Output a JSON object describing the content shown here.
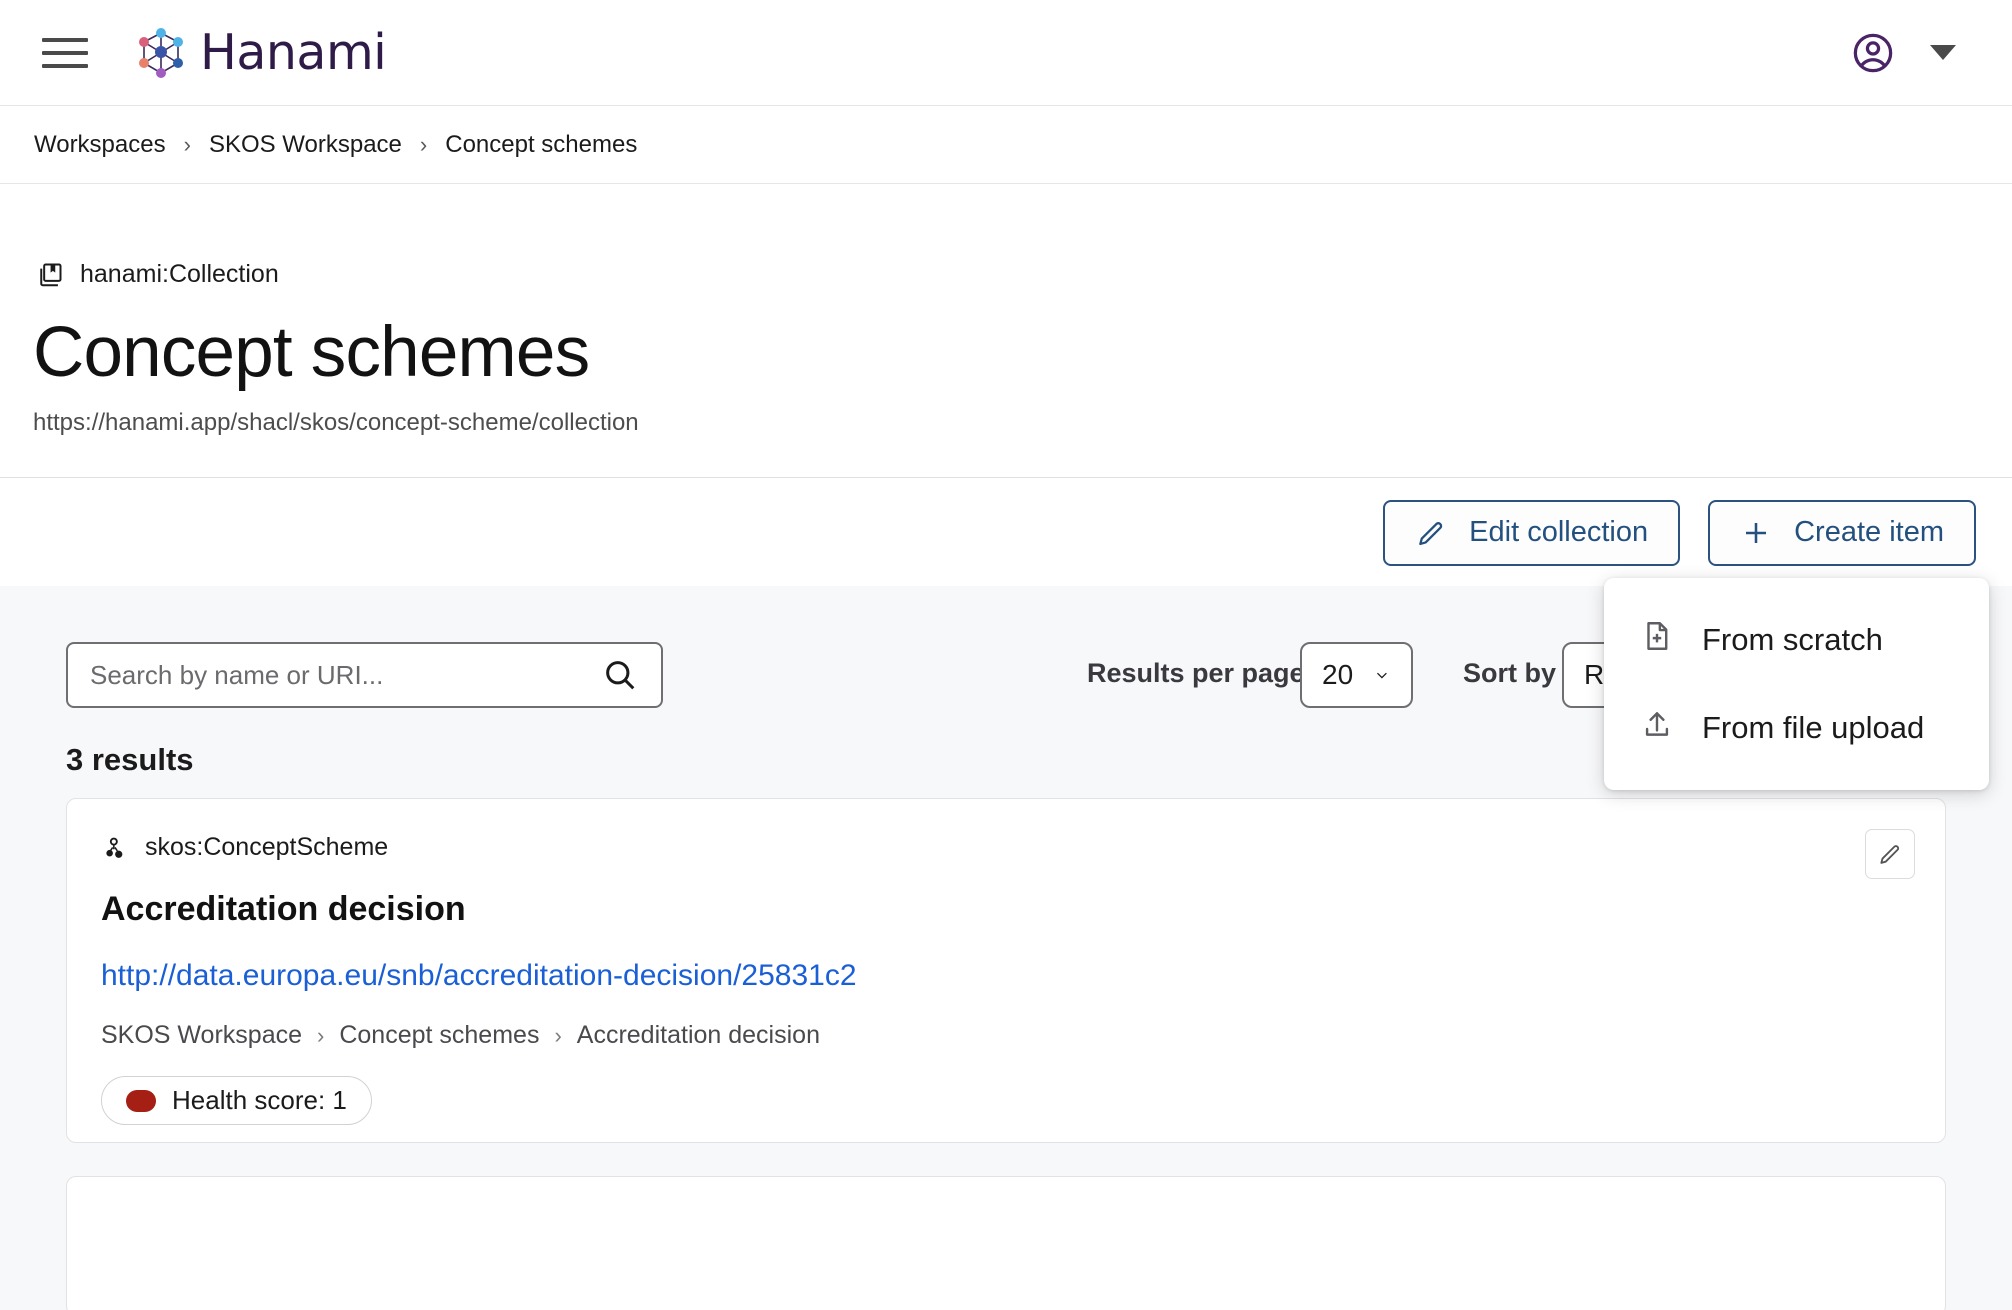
{
  "appbar": {
    "menu_icon": "hamburger-menu-icon",
    "brand_name": "Hanami",
    "logo_icon": "hanami-hexagon-logo",
    "account_icon": "account-circle-icon",
    "caret_icon": "chevron-down-icon"
  },
  "breadcrumb": {
    "separator": "›",
    "items": [
      {
        "label": "Workspaces"
      },
      {
        "label": "SKOS Workspace"
      },
      {
        "label": "Concept schemes"
      }
    ]
  },
  "title_block": {
    "type_icon": "collections-bookmark-icon",
    "type_label": "hanami:Collection",
    "title": "Concept schemes",
    "uri": "https://hanami.app/shacl/skos/concept-scheme/collection"
  },
  "actions": {
    "edit_collection": {
      "label": "Edit collection",
      "icon": "pencil-icon"
    },
    "create_item": {
      "label": "Create item",
      "icon": "plus-icon"
    }
  },
  "create_menu": {
    "items": [
      {
        "label": "From scratch",
        "icon": "note-add-icon"
      },
      {
        "label": "From file upload",
        "icon": "file-upload-icon"
      }
    ]
  },
  "filters": {
    "search_placeholder": "Search by name or URI...",
    "search_value": "",
    "search_icon": "search-icon",
    "results_per_page_label": "Results per page",
    "results_per_page_value": "20",
    "sort_by_label": "Sort by",
    "sort_by_value": "R"
  },
  "results": {
    "count_label": "3 results",
    "cards": [
      {
        "type_icon": "concept-scheme-icon",
        "type_label": "skos:ConceptScheme",
        "title": "Accreditation decision",
        "uri": "http://data.europa.eu/snb/accreditation-decision/25831c2",
        "crumbs": [
          "SKOS Workspace",
          "Concept schemes",
          "Accreditation decision"
        ],
        "crumb_separator": "›",
        "health_badge": {
          "label": "Health score: 1",
          "dot_color": "#a51f14"
        },
        "edit_icon": "pencil-icon"
      }
    ]
  },
  "colors": {
    "brand_purple": "#2f1b48",
    "action_blue": "#24507f",
    "link_blue": "#1a5fd6",
    "health_red": "#a51f14",
    "content_bg": "#f7f8fa"
  }
}
